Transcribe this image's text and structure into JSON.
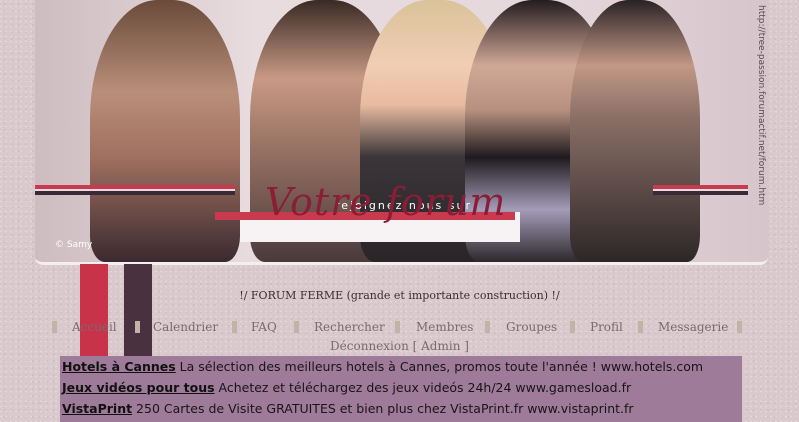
{
  "banner": {
    "tagline": "rejoignez nous sur",
    "logo": "Votre forum",
    "copyright": "© Samy",
    "side_url": "http://tree-passion.forumactif.net/forum.htm"
  },
  "notice": "!/ FORUM FERME (grande et importante construction) !/",
  "nav": {
    "items": [
      "Accueil",
      "Calendrier",
      "FAQ",
      "Rechercher",
      "Membres",
      "Groupes",
      "Profil",
      "Messagerie"
    ],
    "second_row": "Déconnexion [ Admin ]"
  },
  "ads": [
    {
      "title": "Hotels à Cannes",
      "text": " La sélection des meilleurs hotels à Cannes, promos toute l'année ! www.hotels.com"
    },
    {
      "title": "Jeux vidéos pour tous",
      "text": " Achetez et téléchargez des jeux videós 24h/24 www.gamesload.fr"
    },
    {
      "title": "VistaPrint",
      "text": " 250 Cartes de Visite GRATUITES et bien plus chez VistaPrint.fr www.vistaprint.fr"
    }
  ],
  "colors": {
    "accent_red": "#c8334a",
    "accent_dark": "#4a3140",
    "ad_background": "#9e7b99",
    "page_background": "#d9c9cd"
  }
}
